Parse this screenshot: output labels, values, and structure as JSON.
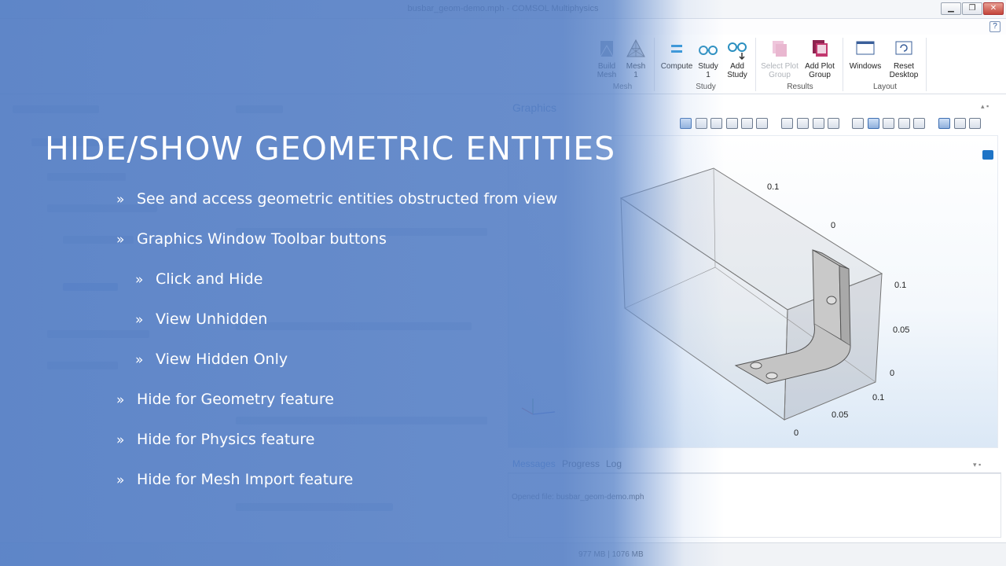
{
  "window": {
    "title": "busbar_geom-demo.mph - COMSOL Multiphysics",
    "min": "▁",
    "max": "❐",
    "close": "✕",
    "help": "?"
  },
  "ribbon": {
    "compute": "Compute",
    "study1": "Study\n1",
    "add_study": "Add\nStudy",
    "select_plot_group": "Select Plot\nGroup",
    "add_plot_group": "Add Plot\nGroup",
    "windows": "Windows",
    "reset_desktop": "Reset\nDesktop",
    "build_mesh": "Build\nMesh",
    "mesh1": "Mesh\n1",
    "groups": {
      "mesh": "Mesh",
      "study": "Study",
      "results": "Results",
      "layout": "Layout"
    }
  },
  "graphics": {
    "title": "Graphics",
    "axis_ticks": {
      "top_0_1": "0.1",
      "top_0": "0",
      "right_0_1": "0.1",
      "right_0_05": "0.05",
      "right_0": "0",
      "bottom_0_1": "0.1",
      "bottom_0_05": "0.05",
      "bottom_0": "0"
    }
  },
  "messages": {
    "tabs": [
      "Messages",
      "Progress",
      "Log"
    ],
    "text": "Opened file: busbar_geom-demo.mph"
  },
  "status": {
    "memory": "977 MB | 1076 MB"
  },
  "slide": {
    "title": "HIDE/SHOW GEOMETRIC ENTITIES",
    "chevron": "»",
    "bullets": [
      "See and access geometric entities obstructed from view",
      "Graphics Window Toolbar buttons",
      "Click and Hide",
      "View Unhidden",
      "View Hidden Only",
      "Hide for Geometry feature",
      "Hide for Physics feature",
      "Hide for Mesh Import feature"
    ]
  },
  "colors": {
    "overlay_blue": "#537dc4",
    "accent": "#2b6cc4"
  }
}
